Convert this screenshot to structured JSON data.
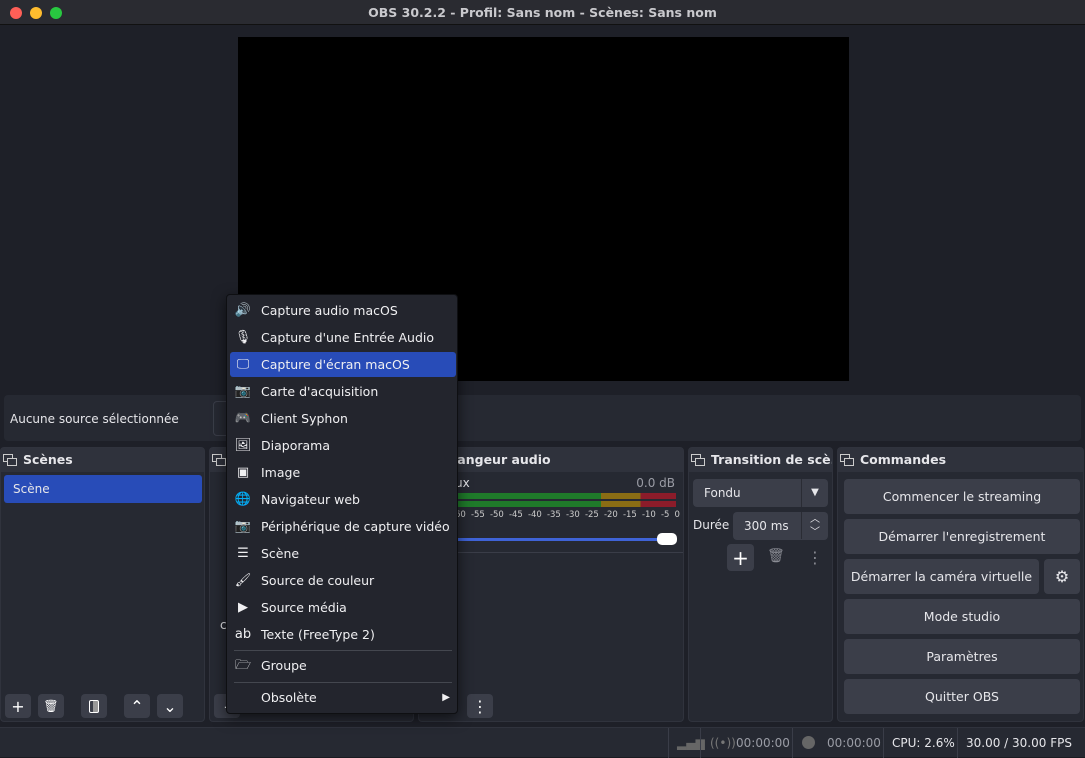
{
  "window": {
    "title": "OBS 30.2.2 - Profil: Sans nom - Scènes: Sans nom"
  },
  "source_bar": {
    "label": "Aucune source sélectionnée"
  },
  "scenes": {
    "title": "Scènes",
    "items": [
      "Scène"
    ]
  },
  "sources": {
    "partial_text": "c"
  },
  "mixer": {
    "title": "langeur audio",
    "channel": "ux",
    "level": "0.0 dB",
    "ticks": [
      "60",
      "-55",
      "-50",
      "-45",
      "-40",
      "-35",
      "-30",
      "-25",
      "-20",
      "-15",
      "-10",
      "-5",
      "0"
    ],
    "volume_fraction": 1.0
  },
  "transitions": {
    "title": "Transition de scè...",
    "selected": "Fondu",
    "duration_label": "Durée",
    "duration_value": "300 ms"
  },
  "controls": {
    "title": "Commandes",
    "buttons": [
      "Commencer le streaming",
      "Démarrer l'enregistrement",
      "Démarrer la caméra virtuelle",
      "Mode studio",
      "Paramètres",
      "Quitter OBS"
    ]
  },
  "status": {
    "stream_time": "00:00:00",
    "record_time": "00:00:00",
    "cpu": "CPU: 2.6%",
    "fps": "30.00 / 30.00 FPS"
  },
  "menu": {
    "items": [
      {
        "label": "Capture audio macOS",
        "icon": "speaker-icon",
        "glyph": "🔊"
      },
      {
        "label": "Capture d'une Entrée Audio",
        "icon": "microphone-icon",
        "glyph": "🎙"
      },
      {
        "label": "Capture d'écran macOS",
        "icon": "monitor-icon",
        "glyph": "🖵",
        "highlighted": true
      },
      {
        "label": "Carte d'acquisition",
        "icon": "camera-icon",
        "glyph": "📷"
      },
      {
        "label": "Client Syphon",
        "icon": "gamepad-icon",
        "glyph": "🎮"
      },
      {
        "label": "Diaporama",
        "icon": "slideshow-icon",
        "glyph": "🖼"
      },
      {
        "label": "Image",
        "icon": "image-icon",
        "glyph": "▣"
      },
      {
        "label": "Navigateur web",
        "icon": "globe-icon",
        "glyph": "🌐"
      },
      {
        "label": "Périphérique de capture vidéo",
        "icon": "camera-icon",
        "glyph": "📷"
      },
      {
        "label": "Scène",
        "icon": "list-icon",
        "glyph": "☰"
      },
      {
        "label": "Source de couleur",
        "icon": "brush-icon",
        "glyph": "🖌"
      },
      {
        "label": "Source média",
        "icon": "play-icon",
        "glyph": "▶"
      },
      {
        "label": "Texte (FreeType 2)",
        "icon": "text-icon",
        "glyph": "ab"
      }
    ],
    "group": {
      "label": "Groupe",
      "glyph": "🗁"
    },
    "deprecated": {
      "label": "Obsolète"
    }
  },
  "colors": {
    "accent": "#284cb8",
    "meter_green": "#1f7a2a",
    "meter_yellow": "#8a6d14",
    "meter_red": "#8c1c2a"
  }
}
